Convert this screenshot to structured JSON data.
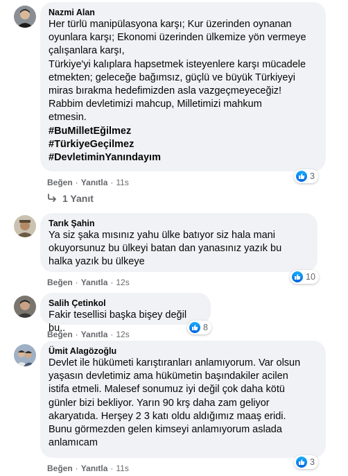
{
  "comments": [
    {
      "author": "Nazmi Alan",
      "lines": [
        "Her türlü manipülasyona karşı; Kur üzerinden oynanan",
        "oyunlara karşı; Ekonomi üzerinden ülkemize yön vermeye",
        "çalışanlara karşı,",
        "Türkiye'yi kalıplara hapsetmek isteyenlere karşı mücadele",
        "etmekten; geleceğe bağımsız, güçlü ve büyük Türkiyeyi",
        "miras bırakma hedefimizden asla vazgeçmeyeceğiz!",
        "Rabbim devletimizi mahcup, Milletimizi mahkum",
        "etmesin."
      ],
      "hashtags": [
        "#BuMilletEğilmez",
        "#TürkiyeGeçilmez",
        "#DevletiminYanındayım"
      ],
      "like_label": "Beğen",
      "reply_label": "Yanıtla",
      "time": "11s",
      "reaction_count": "3",
      "replies_label": "1 Yanıt"
    },
    {
      "author": "Tarık Şahin",
      "lines": [
        "Ya siz şaka mısınız yahu ülke batıyor siz hala mani",
        "okuyorsunuz bu ülkeyi batan dan yanasınız yazık bu",
        "halka yazık bu ülkeye"
      ],
      "like_label": "Beğen",
      "reply_label": "Yanıtla",
      "time": "12s",
      "reaction_count": "10"
    },
    {
      "author": "Salih Çetinkol",
      "lines": [
        "Fakir tesellisi başka bişey değil bu.."
      ],
      "like_label": "Beğen",
      "reply_label": "Yanıtla",
      "time": "12s",
      "reaction_count": "8"
    },
    {
      "author": "Ümit Alagözoğlu",
      "lines": [
        "Devlet ile hükümeti karıştıranları anlamıyorum. Var olsun",
        "yaşasın devletimiz ama hükümetin başındakiler acilen",
        "istifa etmeli. Malesef sonumuz iyi değil çok daha kötü",
        "günler bizi bekliyor. Yarın 90 krş daha zam geliyor",
        "akaryatıda. Herşey 2 3 katı oldu aldığımız maaş eridi.",
        "Bunu görmezden gelen kimseyi anlamıyorum aslada",
        "anlamıcam"
      ],
      "like_label": "Beğen",
      "reply_label": "Yanıtla",
      "time": "11s",
      "reaction_count": "3"
    }
  ],
  "colors": {
    "bubble": "#f0f2f5",
    "meta": "#65676b",
    "like_blue": "#1877f2"
  },
  "icons": [
    "avatar",
    "like-icon",
    "reply-arrow-icon"
  ]
}
